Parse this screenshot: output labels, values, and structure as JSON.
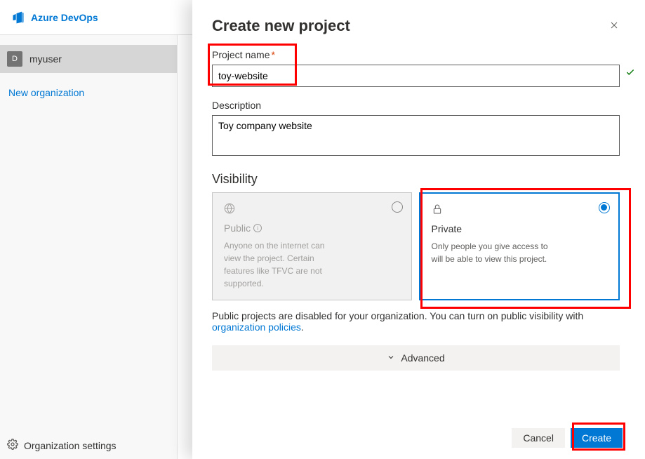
{
  "header": {
    "brand": "Azure DevOps"
  },
  "sidebar": {
    "user_initial": "D",
    "user_name": "myuser",
    "new_org_label": "New organization",
    "org_settings_label": "Organization settings"
  },
  "panel": {
    "title": "Create new project",
    "project_name": {
      "label": "Project name",
      "value": "toy-website"
    },
    "description": {
      "label": "Description",
      "value": "Toy company website"
    },
    "visibility": {
      "label": "Visibility",
      "public": {
        "title": "Public",
        "desc": "Anyone on the internet can view the project. Certain features like TFVC are not supported."
      },
      "private": {
        "title": "Private",
        "desc": "Only people you give access to will be able to view this project."
      }
    },
    "notice_prefix": "Public projects are disabled for your organization. You can turn on public visibility with ",
    "notice_link": "organization policies",
    "notice_suffix": ".",
    "advanced_label": "Advanced",
    "cancel_label": "Cancel",
    "create_label": "Create"
  }
}
